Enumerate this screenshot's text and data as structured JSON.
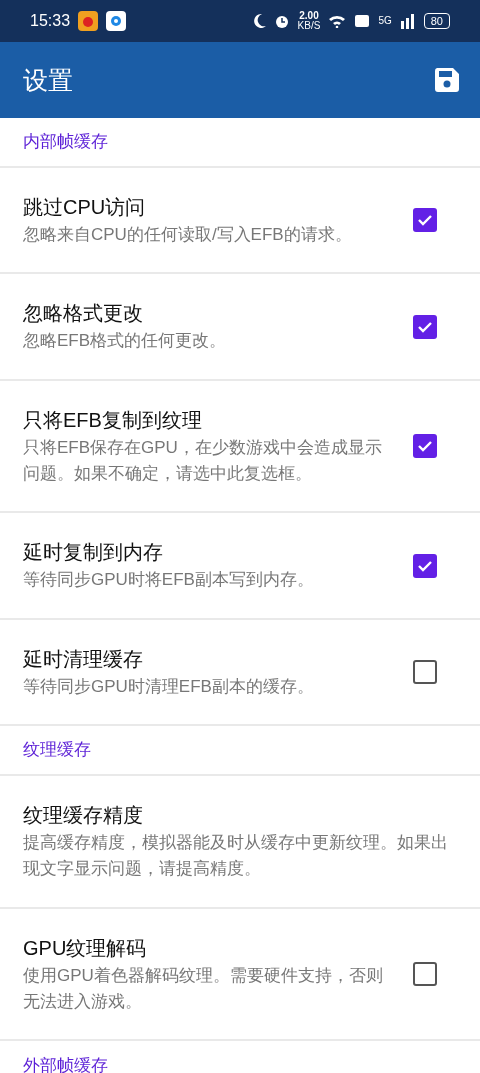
{
  "status_bar": {
    "time": "15:33",
    "speed": "2.00",
    "speed_unit": "KB/S",
    "network": "5G",
    "battery": "80"
  },
  "app_bar": {
    "title": "设置"
  },
  "items": [
    {
      "kind": "header",
      "title": "内部帧缓存"
    },
    {
      "kind": "checkbox",
      "title": "跳过CPU访问",
      "description": "忽略来自CPU的任何读取/写入EFB的请求。",
      "checked": true
    },
    {
      "kind": "checkbox",
      "title": "忽略格式更改",
      "description": "忽略EFB格式的任何更改。",
      "checked": true
    },
    {
      "kind": "checkbox",
      "title": "只将EFB复制到纹理",
      "description": "只将EFB保存在GPU，在少数游戏中会造成显示问题。如果不确定，请选中此复选框。",
      "checked": true
    },
    {
      "kind": "checkbox",
      "title": "延时复制到内存",
      "description": "等待同步GPU时将EFB副本写到内存。",
      "checked": true
    },
    {
      "kind": "checkbox",
      "title": "延时清理缓存",
      "description": "等待同步GPU时清理EFB副本的缓存。",
      "checked": false
    },
    {
      "kind": "header",
      "title": "纹理缓存"
    },
    {
      "kind": "text",
      "title": "纹理缓存精度",
      "description": "提高缓存精度，模拟器能及时从缓存中更新纹理。如果出现文字显示问题，请提高精度。"
    },
    {
      "kind": "checkbox",
      "title": "GPU纹理解码",
      "description": "使用GPU着色器解码纹理。需要硬件支持，否则无法进入游戏。",
      "checked": false
    },
    {
      "kind": "header",
      "title": "外部帧缓存"
    }
  ]
}
